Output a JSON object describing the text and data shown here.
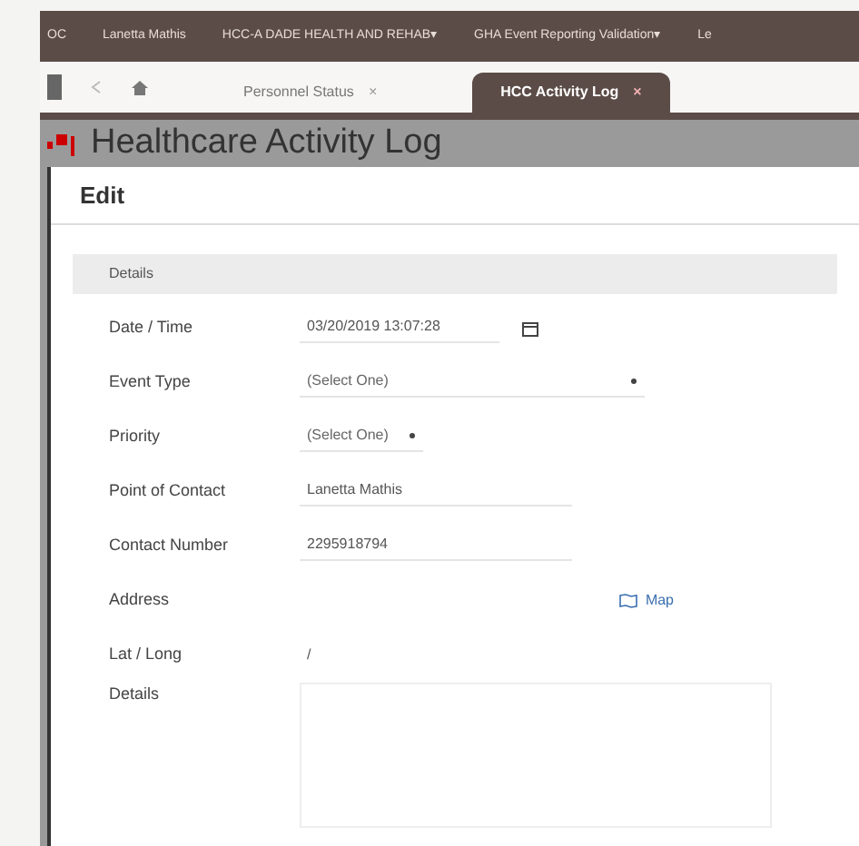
{
  "top_bar": {
    "items": [
      "OC",
      "Lanetta Mathis",
      "HCC-A DADE HEALTH AND REHAB▾",
      "GHA Event Reporting Validation▾",
      "Le"
    ]
  },
  "tabs": [
    {
      "label": "Personnel Status",
      "close": "×",
      "selected": false
    },
    {
      "label": "HCC Activity Log",
      "close": "×",
      "selected": true
    }
  ],
  "page_title": "Healthcare Activity Log",
  "dialog": {
    "title": "Edit",
    "section": "Details",
    "fields": [
      {
        "kind": "date",
        "label": "Date / Time",
        "value": "03/20/2019 13:07:28"
      },
      {
        "kind": "select",
        "label": "Event Type",
        "value": "(Select One)",
        "wide": true
      },
      {
        "kind": "select",
        "label": "Priority",
        "value": "(Select One)",
        "wide": false
      },
      {
        "kind": "text",
        "label": "Point of Contact",
        "value": "Lanetta Mathis"
      },
      {
        "kind": "text",
        "label": "Contact Number",
        "value": "2295918794"
      },
      {
        "kind": "address",
        "label": "Address",
        "link": "Map"
      },
      {
        "kind": "plain",
        "label": "Lat / Long",
        "value": "/"
      },
      {
        "kind": "textarea",
        "label": "Details"
      }
    ]
  }
}
